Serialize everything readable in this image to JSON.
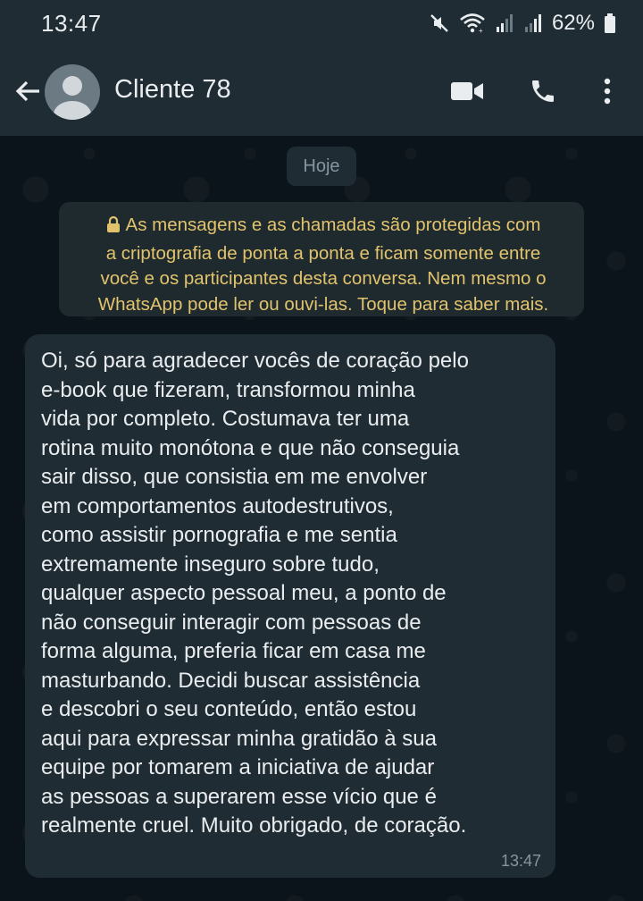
{
  "status_bar": {
    "time": "13:47",
    "battery": "62%",
    "icons": [
      "mute-icon",
      "wifi-icon",
      "signal-icon",
      "signal-icon",
      "battery-icon"
    ]
  },
  "header": {
    "contact_name": "Cliente 78",
    "icons": [
      "back-arrow-icon",
      "avatar",
      "video-call-icon",
      "phone-icon",
      "more-vert-icon"
    ]
  },
  "chat": {
    "date_label": "Hoje",
    "encryption_notice": {
      "icon": "lock-icon",
      "lines": [
        "As mensagens e as chamadas são protegidas com",
        "a criptografia de ponta a ponta e ficam somente entre",
        "você e os participantes desta conversa. Nem mesmo o",
        "WhatsApp pode ler ou ouvi-las. Toque para saber mais."
      ]
    },
    "message": {
      "lines": [
        "Oi, só para agradecer vocês de coração pelo",
        "e-book que fizeram, transformou minha",
        "vida por completo. Costumava ter uma",
        "rotina muito monótona e que não conseguia",
        "sair disso, que consistia em me envolver",
        "em comportamentos autodestrutivos,",
        "como assistir pornografia e me sentia",
        "extremamente inseguro sobre tudo,",
        "qualquer aspecto pessoal meu, a ponto de",
        "não conseguir interagir com pessoas de",
        "forma alguma, preferia ficar em casa me",
        "masturbando. Decidi buscar assistência",
        "e descobri o seu conteúdo, então estou",
        "aqui para expressar minha gratidão à sua",
        "equipe por tomarem a iniciativa de ajudar",
        "as pessoas a superarem esse vício que é",
        "realmente cruel. Muito obrigado, de coração."
      ],
      "time": "13:47"
    }
  },
  "colors": {
    "background": "#0b141a",
    "header": "#1f2c34",
    "bubble": "#202c33",
    "notice_text": "#e2c36d",
    "secondary_text": "#8696a0"
  }
}
